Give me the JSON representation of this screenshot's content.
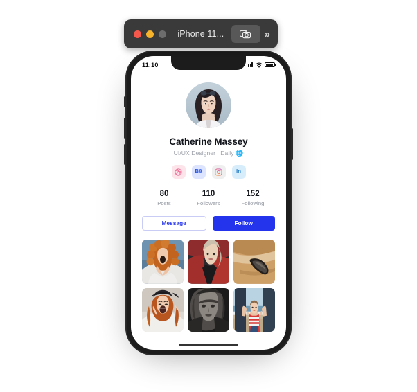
{
  "window": {
    "title": "iPhone 11...",
    "traffic_lights": [
      {
        "name": "close",
        "color": "#f5584b"
      },
      {
        "name": "minimize",
        "color": "#f7b32a"
      },
      {
        "name": "maximize",
        "color": "#6d6d6d"
      }
    ],
    "camera_button_icon": "camera-icon",
    "overflow_label": "»"
  },
  "status_bar": {
    "time": "11:10",
    "icons": [
      "cellular-signal-icon",
      "wifi-icon",
      "battery-icon"
    ]
  },
  "profile": {
    "avatar_alt": "avatar",
    "name": "Catherine Massey",
    "bio": "UI/UX Designer | Daily",
    "bio_emoji": "🌐"
  },
  "socials": [
    {
      "name": "dribbble",
      "label": "",
      "bg": "#fde4ea",
      "fg": "#ef6a94"
    },
    {
      "name": "behance",
      "label": "Bē",
      "bg": "#dde4fd",
      "fg": "#2b5bea"
    },
    {
      "name": "instagram",
      "label": "",
      "bg": "#efefef",
      "fg": "#e8657f"
    },
    {
      "name": "linkedin",
      "label": "in",
      "bg": "#d8edfb",
      "fg": "#1f7bc1"
    }
  ],
  "stats": [
    {
      "value": "80",
      "label": "Posts"
    },
    {
      "value": "110",
      "label": "Followers"
    },
    {
      "value": "152",
      "label": "Following"
    }
  ],
  "actions": {
    "message_label": "Message",
    "follow_label": "Follow"
  },
  "gallery": [
    {
      "name": "photo-curly-hair-woman",
      "alt": "Woman with curly red hair"
    },
    {
      "name": "photo-blonde-red-jacket",
      "alt": "Blonde woman in red jacket"
    },
    {
      "name": "photo-boat-aerial",
      "alt": "Aerial view of boat on sand"
    },
    {
      "name": "photo-cap-laughing-woman",
      "alt": "Laughing woman in cap"
    },
    {
      "name": "photo-bw-portrait",
      "alt": "Black and white portrait"
    },
    {
      "name": "photo-child-beach",
      "alt": "Child on beach holding hands"
    }
  ],
  "colors": {
    "accent": "#2433ec",
    "text_primary": "#12151c",
    "text_muted": "#8e939d",
    "device_frame": "#1c1c1c",
    "titlebar_bg": "#3a3a3a"
  }
}
